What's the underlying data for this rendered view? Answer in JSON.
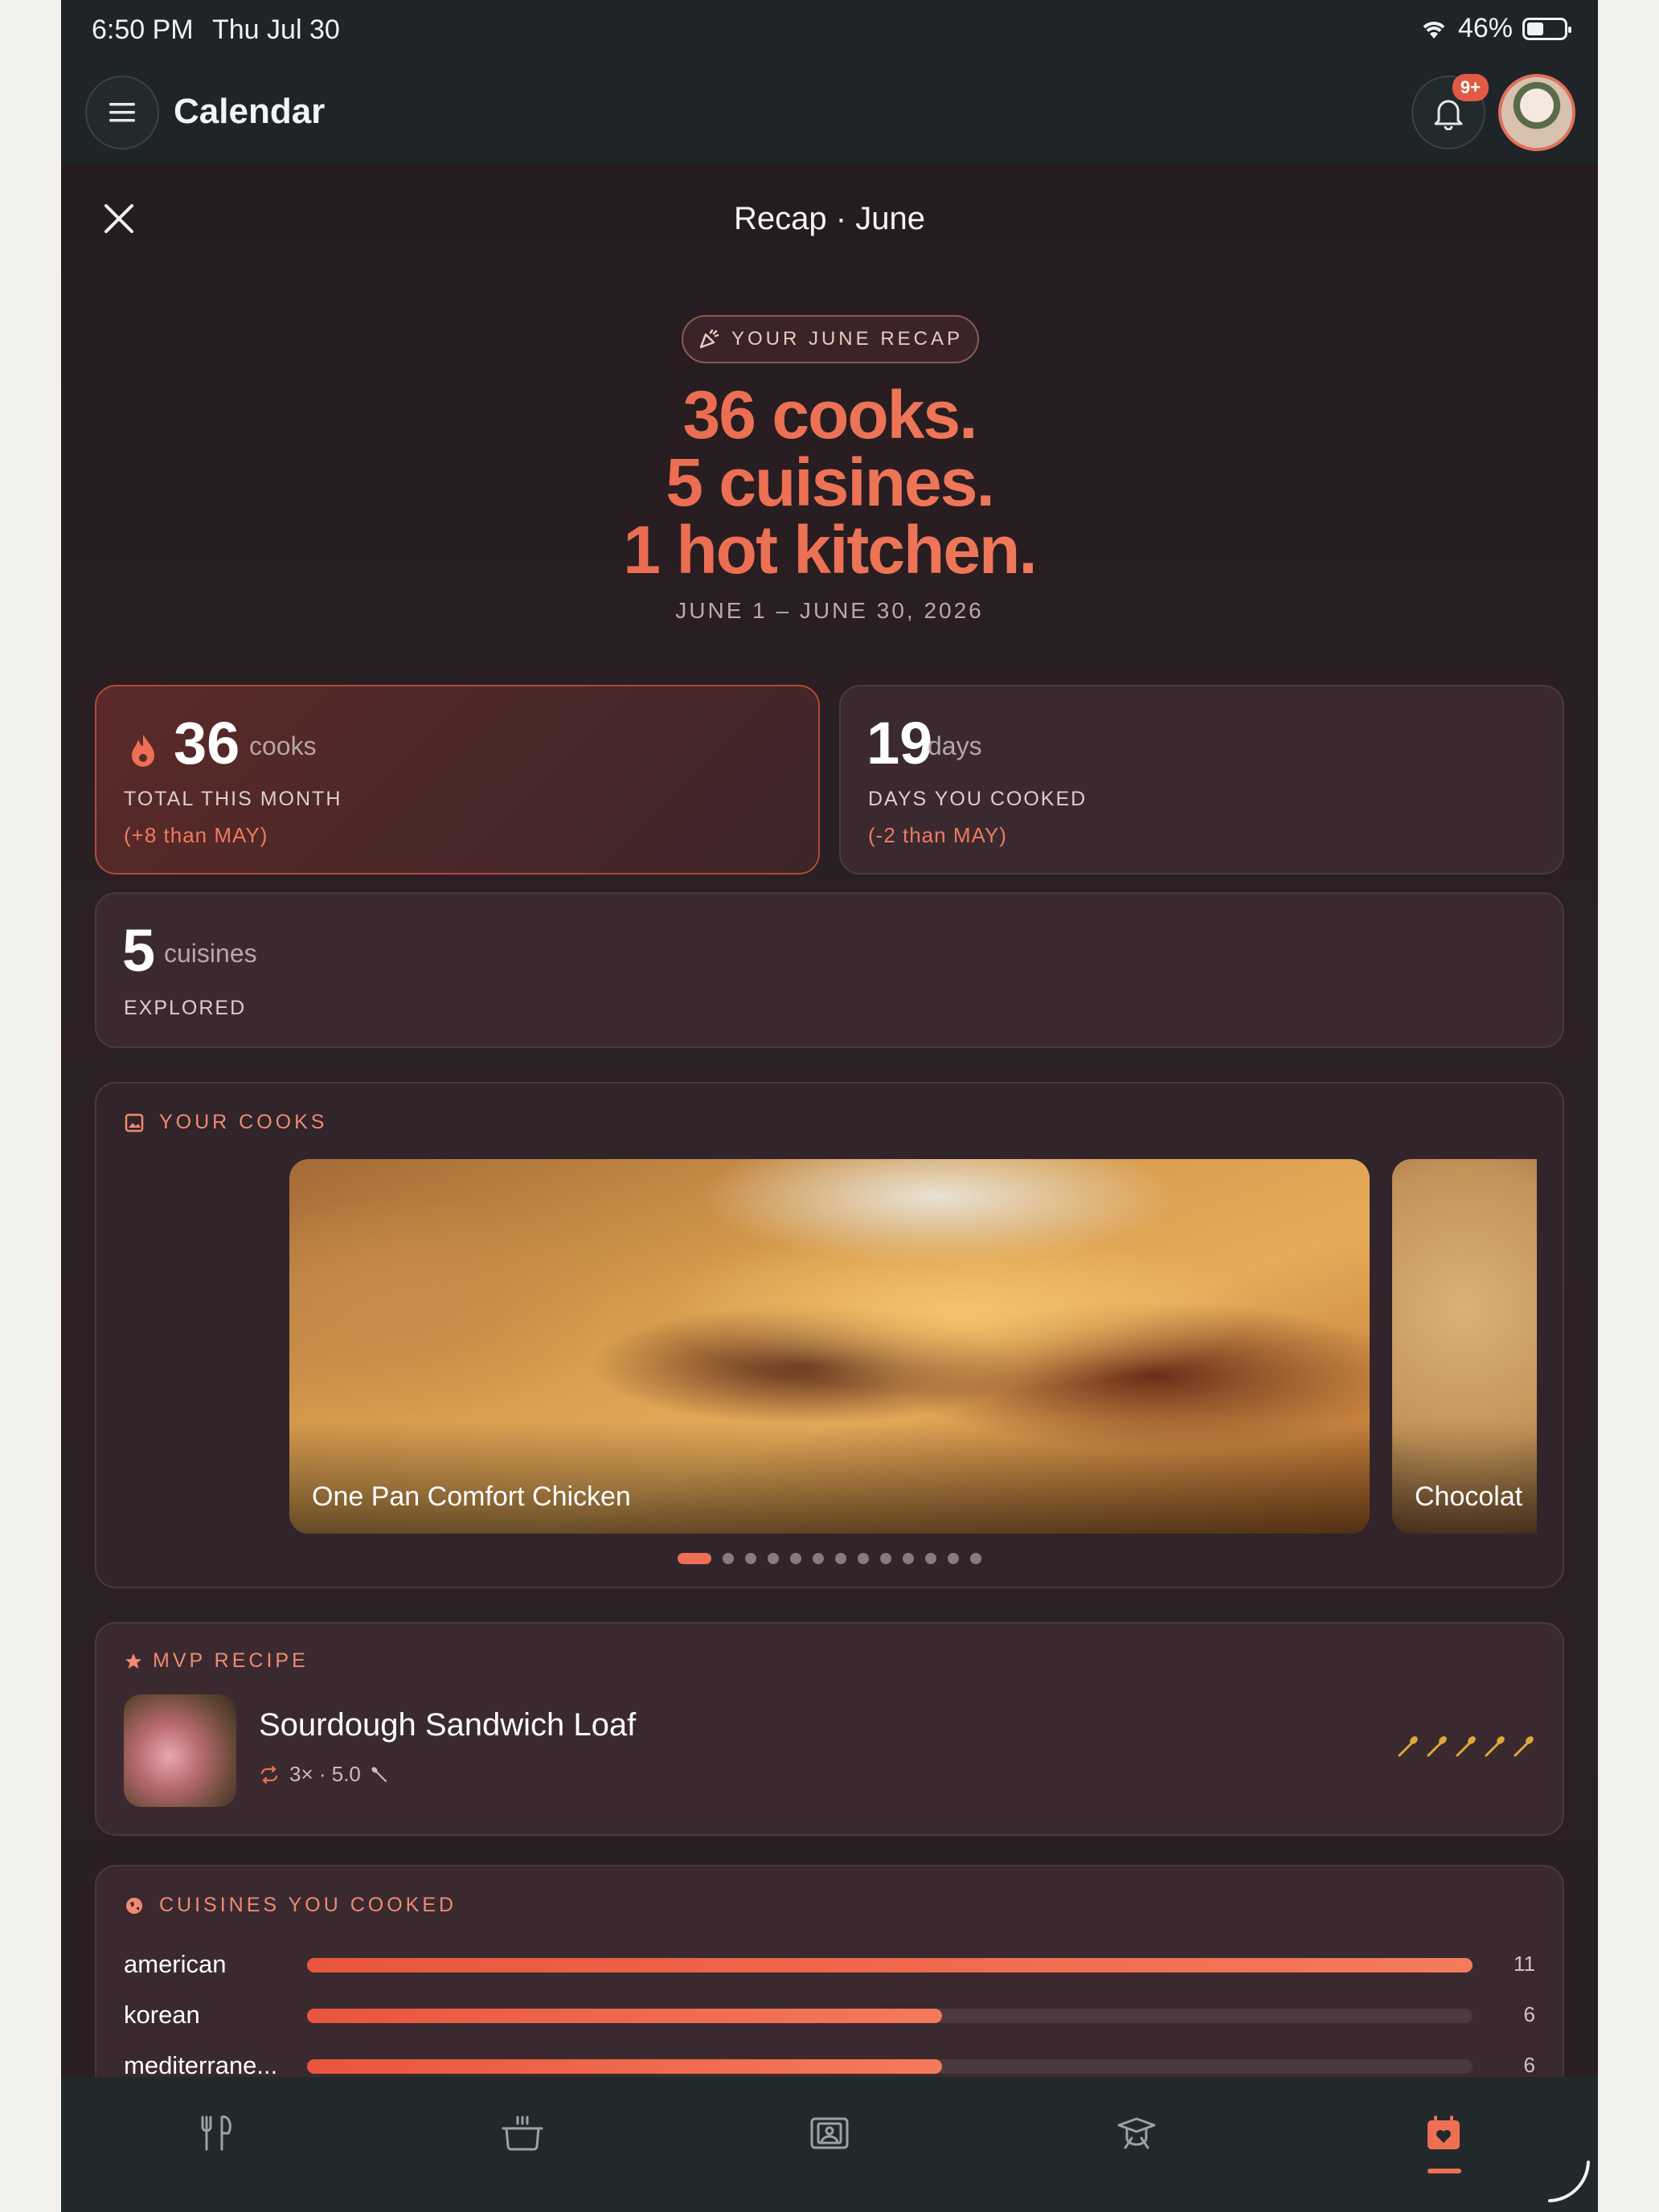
{
  "status_bar": {
    "time": "6:50 PM",
    "date": "Thu Jul 30",
    "battery": "46%"
  },
  "app_bar": {
    "title": "Calendar",
    "notification_badge": "9+"
  },
  "modal": {
    "title": "Recap · June",
    "pill_label": "YOUR JUNE RECAP",
    "headline": [
      "36 cooks.",
      "5 cuisines.",
      "1 hot kitchen."
    ],
    "date_range": "JUNE 1 – JUNE 30, 2026"
  },
  "stats": {
    "cooks": {
      "value": "36",
      "unit": "cooks",
      "label": "TOTAL THIS MONTH",
      "delta": "(+8 than MAY)"
    },
    "days": {
      "value": "19",
      "unit": "days",
      "label": "DAYS YOU COOKED",
      "delta": "(-2 than MAY)"
    },
    "cuisines": {
      "value": "5",
      "unit": "cuisines",
      "label": "EXPLORED"
    }
  },
  "your_cooks": {
    "title": "YOUR COOKS",
    "photos": [
      {
        "caption": "One Pan Comfort Chicken"
      },
      {
        "caption": "Chocolat"
      }
    ],
    "dots_total": 13,
    "dots_active": 0
  },
  "mvp": {
    "title": "MVP RECIPE",
    "name": "Sourdough Sandwich Loaf",
    "meta": "3× · 5.0",
    "rating": 5
  },
  "cuisines_section": {
    "title": "CUISINES YOU COOKED",
    "max": 11,
    "rows": [
      {
        "label": "american",
        "value": "11",
        "fraction": 1.0
      },
      {
        "label": "korean",
        "value": "6",
        "fraction": 0.545
      },
      {
        "label": "mediterrane...",
        "value": "6",
        "fraction": 0.545
      }
    ]
  },
  "colors": {
    "accent": "#ef6f55",
    "background": "#2a1f23",
    "bar_gold": "#e0a83a"
  },
  "tabs": [
    {
      "icon": "utensils-icon"
    },
    {
      "icon": "pot-icon"
    },
    {
      "icon": "gallery-icon"
    },
    {
      "icon": "graduation-cap-icon"
    },
    {
      "icon": "calendar-heart-icon",
      "active": true
    }
  ]
}
